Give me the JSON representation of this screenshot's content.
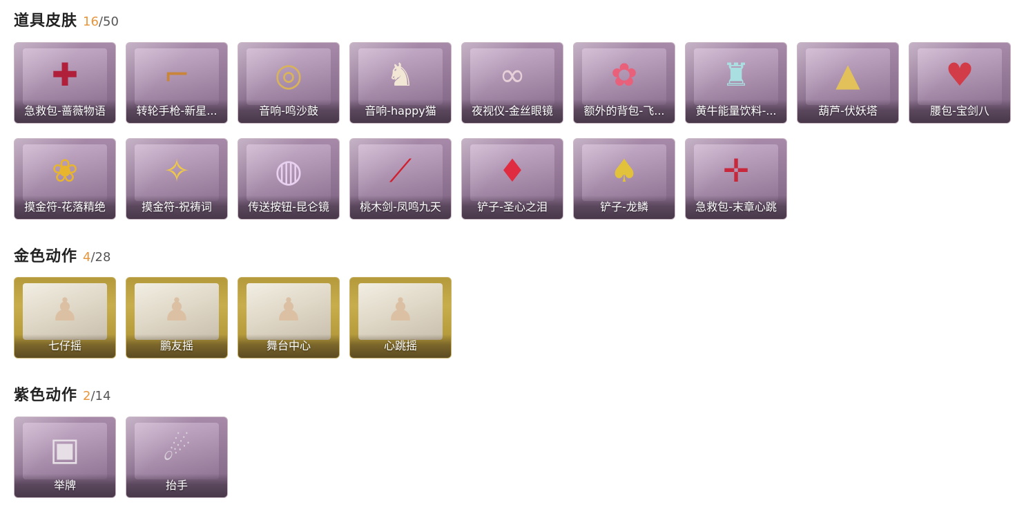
{
  "sections": [
    {
      "title": "道具皮肤",
      "owned": "16",
      "total": "/50",
      "theme": "purple",
      "items": [
        {
          "label": "急救包-蔷薇物语",
          "icon": "first-aid-kit-icon",
          "glyph": "✚",
          "color": "#b0203a"
        },
        {
          "label": "转轮手枪-新星...",
          "icon": "revolver-icon",
          "glyph": "⌐",
          "color": "#c9863a"
        },
        {
          "label": "音响-鸣沙鼓",
          "icon": "drum-icon",
          "glyph": "◎",
          "color": "#d8b35a"
        },
        {
          "label": "音响-happy猫",
          "icon": "cat-figure-icon",
          "glyph": "♞",
          "color": "#f2e7d4"
        },
        {
          "label": "夜视仪-金丝眼镜",
          "icon": "glasses-icon",
          "glyph": "∞",
          "color": "#e7d0d8"
        },
        {
          "label": "额外的背包-飞...",
          "icon": "flower-bouquet-icon",
          "glyph": "✿",
          "color": "#e8607a"
        },
        {
          "label": "黄牛能量饮料-...",
          "icon": "bottle-icon",
          "glyph": "♜",
          "color": "#a9dfe0"
        },
        {
          "label": "葫芦-伏妖塔",
          "icon": "pagoda-icon",
          "glyph": "▲",
          "color": "#e2c15a"
        },
        {
          "label": "腰包-宝剑八",
          "icon": "heart-pouch-icon",
          "glyph": "♥",
          "color": "#d23c48"
        },
        {
          "label": "摸金符-花落精绝",
          "icon": "flower-charm-icon",
          "glyph": "❀",
          "color": "#e8b52e"
        },
        {
          "label": "摸金符-祝祷词",
          "icon": "knot-charm-icon",
          "glyph": "✧",
          "color": "#f0c848"
        },
        {
          "label": "传送按钮-昆仑镜",
          "icon": "mirror-icon",
          "glyph": "◍",
          "color": "#e8d0f0"
        },
        {
          "label": "桃木剑-凤鸣九天",
          "icon": "sword-icon",
          "glyph": "⟋",
          "color": "#d02030"
        },
        {
          "label": "铲子-圣心之泪",
          "icon": "shovel-heart-icon",
          "glyph": "♦",
          "color": "#e02c40"
        },
        {
          "label": "铲子-龙鳞",
          "icon": "golden-shovel-icon",
          "glyph": "♠",
          "color": "#e2c23a"
        },
        {
          "label": "急救包-末章心跳",
          "icon": "syringe-icon",
          "glyph": "✛",
          "color": "#c8283c"
        }
      ]
    },
    {
      "title": "金色动作",
      "owned": "4",
      "total": "/28",
      "theme": "gold",
      "items": [
        {
          "label": "七仔摇",
          "icon": "dance-pose-icon",
          "glyph": "♟",
          "color": "#dcc0a4"
        },
        {
          "label": "鹏友摇",
          "icon": "dance-pose-icon",
          "glyph": "♟",
          "color": "#dcc0a4"
        },
        {
          "label": "舞台中心",
          "icon": "dance-pose-icon",
          "glyph": "♟",
          "color": "#dcc0a4"
        },
        {
          "label": "心跳摇",
          "icon": "dance-pose-icon",
          "glyph": "♟",
          "color": "#dcc0a4"
        }
      ]
    },
    {
      "title": "紫色动作",
      "owned": "2",
      "total": "/14",
      "theme": "purple",
      "items": [
        {
          "label": "举牌",
          "icon": "sign-holding-icon",
          "glyph": "▣",
          "color": "#e6e0e6"
        },
        {
          "label": "抬手",
          "icon": "raise-hand-icon",
          "glyph": "☄",
          "color": "#d8d0da"
        }
      ]
    }
  ]
}
